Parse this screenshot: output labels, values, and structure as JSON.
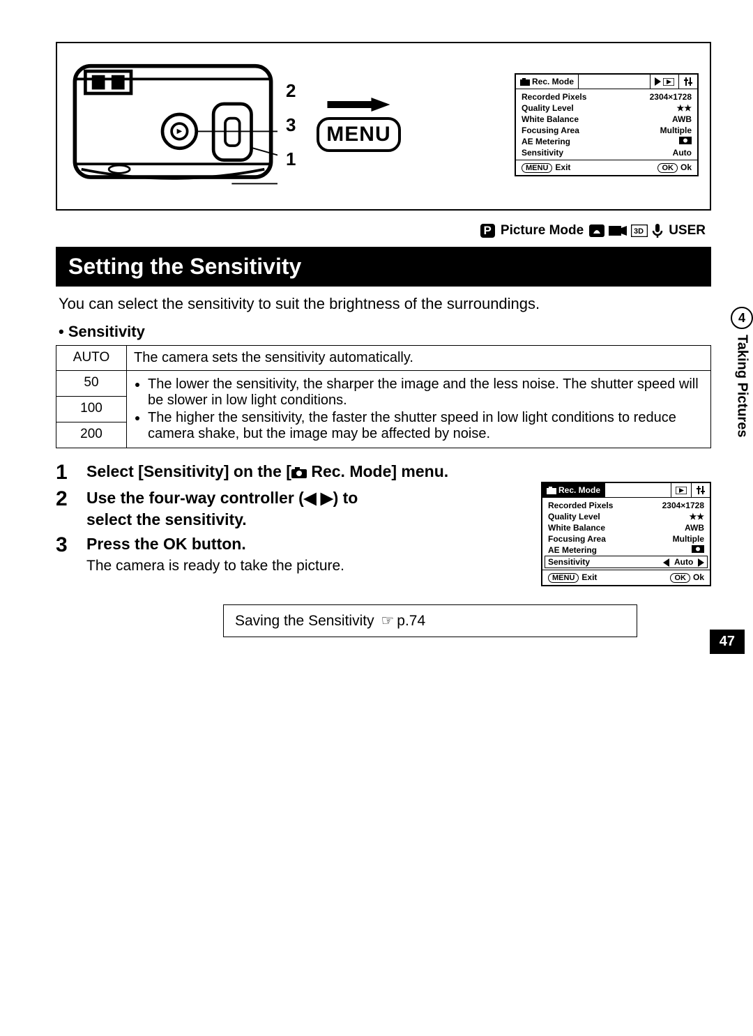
{
  "page_number": "47",
  "side_tab": {
    "number": "4",
    "label": "Taking Pictures"
  },
  "callouts": {
    "a": "2",
    "b": "3",
    "c": "1"
  },
  "menu_button": "MENU",
  "lcd_top": {
    "tab_active": "Rec. Mode",
    "rows": [
      {
        "label": "Recorded Pixels",
        "value": "2304×1728"
      },
      {
        "label": "Quality Level",
        "value_stars": true
      },
      {
        "label": "White Balance",
        "value": "AWB"
      },
      {
        "label": "Focusing Area",
        "value": "Multiple"
      },
      {
        "label": "AE Metering",
        "value_icon": "metering"
      },
      {
        "label": "Sensitivity",
        "value": "Auto"
      }
    ],
    "footer_left_btn": "MENU",
    "footer_left": "Exit",
    "footer_right_btn": "OK",
    "footer_right": "Ok"
  },
  "mode_line": {
    "p": "P",
    "label": "Picture Mode",
    "user": "USER"
  },
  "section_title": "Setting the Sensitivity",
  "intro": "You can select the sensitivity to suit the brightness of the surroundings.",
  "sub_heading": "• Sensitivity",
  "table": {
    "auto_label": "AUTO",
    "auto_desc": "The camera sets the sensitivity automatically.",
    "r50": "50",
    "r100": "100",
    "r200": "200",
    "bullet1": "The lower the sensitivity, the sharper the image and the less noise. The shutter speed will be slower in low light conditions.",
    "bullet2": "The higher the sensitivity, the faster the shutter speed in low light conditions to reduce camera shake, but the image may be affected by noise."
  },
  "steps": {
    "s1": {
      "num": "1",
      "head_a": "Select [Sensitivity] on the [",
      "head_b": " Rec. Mode] menu."
    },
    "s2": {
      "num": "2",
      "head": "Use the four-way controller (◀ ▶) to select the sensitivity."
    },
    "s3": {
      "num": "3",
      "head": "Press the OK button.",
      "body": "The camera is ready to take the picture."
    }
  },
  "lcd_bottom": {
    "tab_active": "Rec. Mode",
    "rows": [
      {
        "label": "Recorded Pixels",
        "value": "2304×1728"
      },
      {
        "label": "Quality Level",
        "value_stars": true
      },
      {
        "label": "White Balance",
        "value": "AWB"
      },
      {
        "label": "Focusing Area",
        "value": "Multiple"
      },
      {
        "label": "AE Metering",
        "value_icon": "metering"
      }
    ],
    "selected": {
      "label": "Sensitivity",
      "value": "Auto"
    },
    "footer_left_btn": "MENU",
    "footer_left": "Exit",
    "footer_right_btn": "OK",
    "footer_right": "Ok"
  },
  "reference": {
    "text": "Saving the Sensitivity ",
    "page": "p.74"
  }
}
